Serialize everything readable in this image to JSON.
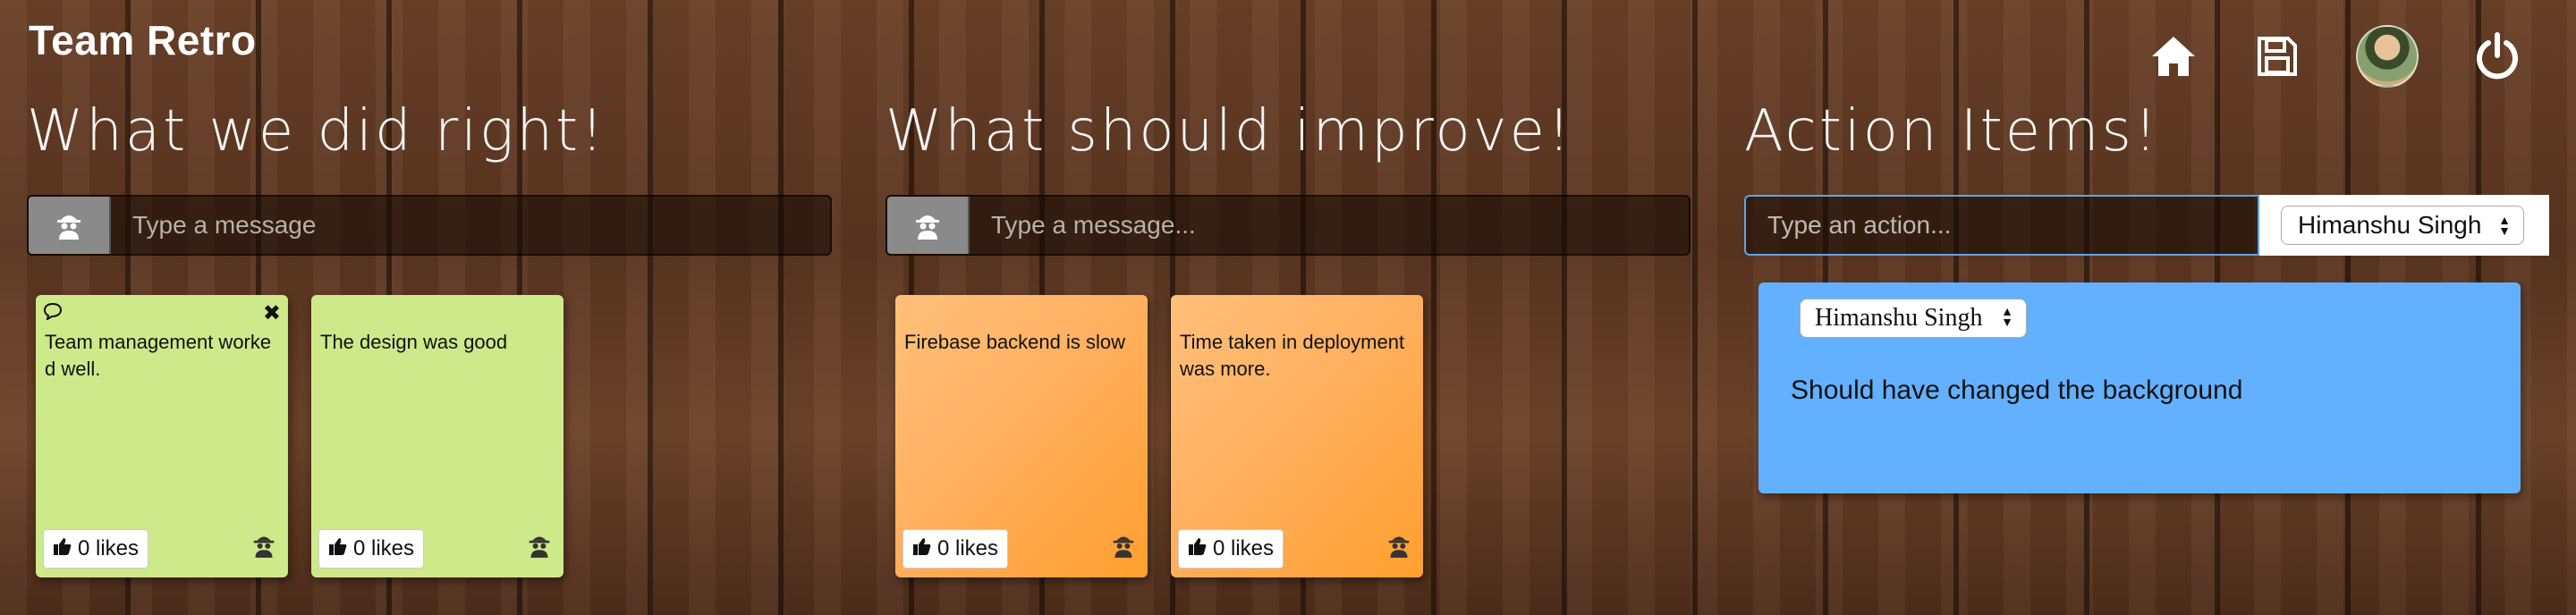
{
  "app": {
    "title": "Team Retro"
  },
  "toolbar": {
    "icons": [
      "home-icon",
      "save-icon",
      "avatar",
      "power-icon"
    ]
  },
  "columns": {
    "right": {
      "heading": "What we did right!",
      "placeholder": "Type a message",
      "cards": [
        {
          "text": "Team management worked well.",
          "likes": "0 likes"
        },
        {
          "text": "The design was good",
          "likes": "0 likes"
        }
      ]
    },
    "improve": {
      "heading": "What should improve!",
      "placeholder": "Type a message...",
      "cards": [
        {
          "text": "Firebase backend is slow",
          "likes": "0 likes"
        },
        {
          "text": "Time taken in deployment was more.",
          "likes": "0 likes"
        }
      ]
    },
    "actions": {
      "heading": "Action Items!",
      "placeholder": "Type an action...",
      "assignee": "Himanshu Singh",
      "items": [
        {
          "assignee": "Himanshu Singh",
          "text": "Should have changed the background"
        }
      ]
    }
  },
  "colors": {
    "green_card": "#cde98a",
    "orange_card": "#ffb060",
    "action_card": "#63b0ff"
  }
}
